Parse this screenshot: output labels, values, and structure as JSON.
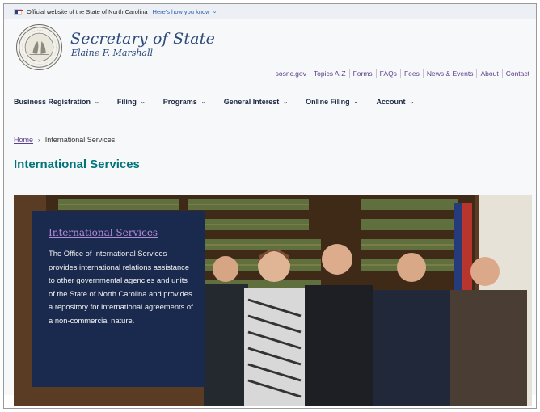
{
  "banner": {
    "text": "Official website of the State of North Carolina",
    "link": "Here's how you know"
  },
  "brand": {
    "title": "Secretary of State",
    "subtitle": "Elaine F. Marshall"
  },
  "utility_nav": [
    "sosnc.gov",
    "Topics A-Z",
    "Forms",
    "FAQs",
    "Fees",
    "News & Events",
    "About",
    "Contact"
  ],
  "main_nav": [
    "Business Registration",
    "Filing",
    "Programs",
    "General Interest",
    "Online Filing",
    "Account"
  ],
  "breadcrumb": {
    "home": "Home",
    "current": "International Services"
  },
  "page_title": "International Services",
  "card": {
    "title": "International Services",
    "body": "The Office of International Services provides international relations assistance to other governmental agencies and units of the State of North Carolina and provides a repository for international agreements of a non-commercial nature."
  },
  "colors": {
    "title_teal": "#00747a",
    "link_purple": "#5b3f8a",
    "card_navy": "#1a2a4e",
    "brand_blue": "#2c4a7a"
  }
}
